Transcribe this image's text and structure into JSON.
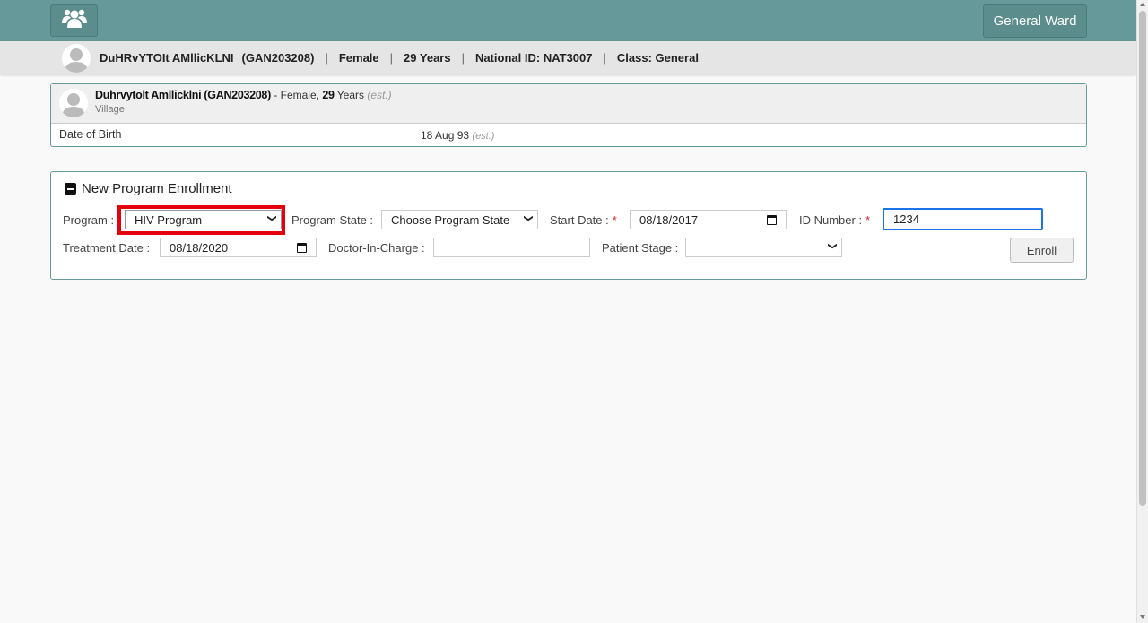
{
  "topbar": {
    "home_icon": "group-icon",
    "ward_label": "General Ward"
  },
  "patient_header": {
    "name": "DuHRvYTOIt AMllicKLNI",
    "id": "(GAN203208)",
    "gender": "Female",
    "age": "29 Years",
    "national_id": "National ID: NAT3007",
    "class": "Class: General"
  },
  "info_panel": {
    "name": "Duhrvytolt Amllicklni (GAN203208)",
    "gender_prefix": "- Female, ",
    "age_num": "29",
    "age_unit": " Years ",
    "age_est": "(est.)",
    "village": "Village",
    "dob_label": "Date of Birth",
    "dob_value": "18 Aug 93",
    "dob_est": "(est.)"
  },
  "enrollment": {
    "title": "New Program Enrollment",
    "program_label": "Program :",
    "program_value": "HIV Program",
    "state_label": "Program State :",
    "state_value": "Choose Program State",
    "start_label": "Start Date :",
    "start_value": "08/18/2017",
    "id_label": "ID Number :",
    "id_value": "1234",
    "treatment_label": "Treatment Date :",
    "treatment_value": "08/18/2020",
    "doctor_label": "Doctor-In-Charge :",
    "doctor_value": "",
    "stage_label": "Patient Stage :",
    "stage_value": "",
    "enroll_label": "Enroll",
    "required_mark": "*"
  },
  "colors": {
    "topbar": "#669999",
    "highlight": "#e5000f",
    "required": "#d9222a",
    "focus": "#1a73e8"
  }
}
